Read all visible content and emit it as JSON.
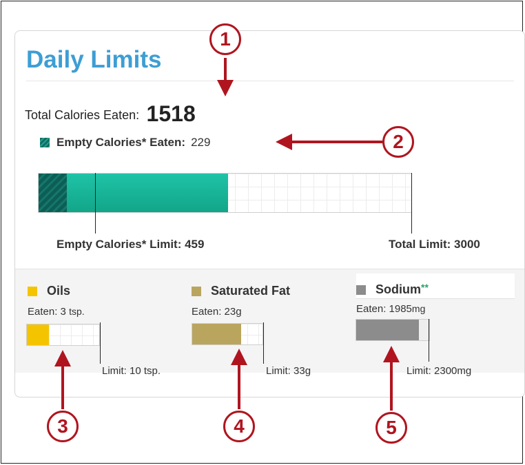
{
  "panel": {
    "title": "Daily Limits",
    "total_calories_label": "Total Calories Eaten:",
    "total_calories_value": "1518",
    "empty_calories_label": "Empty Calories* Eaten:",
    "empty_calories_value": "229",
    "empty_limit_label": "Empty Calories* Limit: 459",
    "total_limit_label": "Total Limit: 3000"
  },
  "calorie_bar": {
    "empty_calories_eaten": 229,
    "empty_calories_limit": 459,
    "total_eaten": 1518,
    "total_limit": 3000
  },
  "nutrients": {
    "oils": {
      "name": "Oils",
      "eaten_prefix": "Eaten: 3",
      "eaten_unit": "tsp.",
      "limit": "Limit: 10 tsp.",
      "fill_fraction": 0.3,
      "color": "#f5c400"
    },
    "saturated_fat": {
      "name": "Saturated Fat",
      "eaten": "Eaten: 23g",
      "limit": "Limit: 33g",
      "fill_fraction": 0.7,
      "color": "#b9a55e"
    },
    "sodium": {
      "name": "Sodium",
      "name_suffix": "**",
      "eaten_prefix": "Eaten: 1985",
      "eaten_unit": "mg",
      "limit": "Limit: 2300mg",
      "fill_fraction": 0.86,
      "color": "#8c8c8c"
    }
  },
  "callouts": [
    "1",
    "2",
    "3",
    "4",
    "5"
  ],
  "colors": {
    "title": "#3d9ed4",
    "callout": "#b0151f",
    "teal_fill": "#12a589",
    "teal_dark": "#0c5e55"
  }
}
